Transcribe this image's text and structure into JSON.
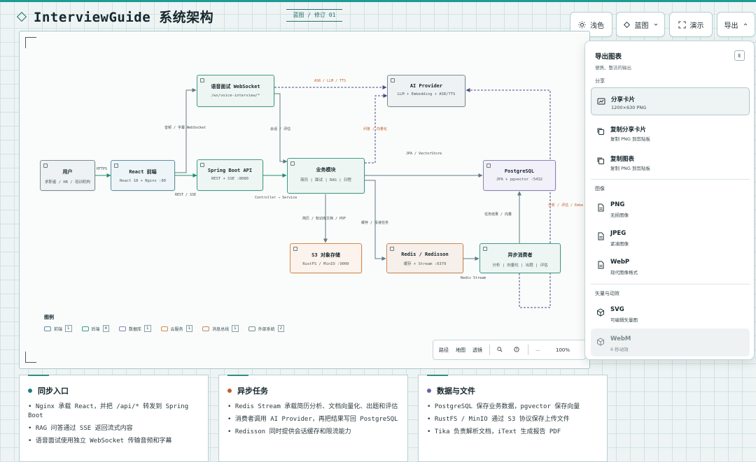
{
  "header": {
    "title": "InterviewGuide 系统架构",
    "revision": "蓝图 / 修订 01"
  },
  "toolbar": {
    "theme_label": "浅色",
    "style_label": "蓝图",
    "present_label": "演示",
    "export_label": "导出"
  },
  "diagram": {
    "nodes": {
      "user": {
        "title": "用户",
        "sub": "求职者 / HR / 培训机构"
      },
      "react": {
        "title": "React 前端",
        "sub": "React 18 + Nginx :80"
      },
      "voice": {
        "title": "语音面试 WebSocket",
        "sub": "/ws/voice-interview/*"
      },
      "spring": {
        "title": "Spring Boot API",
        "sub": "REST + SSE :8080"
      },
      "business": {
        "title": "业务模块",
        "sub": "简历 | 面试 | RAG | 日程"
      },
      "ai": {
        "title": "AI Provider",
        "sub": "LLM + Embedding + ASR/TTS"
      },
      "pg": {
        "title": "PostgreSQL",
        "sub": "JPA + pgvector :5432"
      },
      "s3": {
        "title": "S3 对象存储",
        "sub": "RustFS / MinIO :9000"
      },
      "redis": {
        "title": "Redis / Redisson",
        "sub": "缓存 + Stream :6379"
      },
      "consumer": {
        "title": "异步消费者",
        "sub": "分析 | 向量化 | 出题 | 评估"
      }
    },
    "edge_labels": {
      "https": "HTTPS",
      "rest_sse": "REST / SSE",
      "audio": "音频 / 字幕 WebSocket",
      "asr": "ASR / LLM / TTS",
      "session": "会话 / 评估",
      "controller": "Controller → Service",
      "jpa": "JPA / VectorStore",
      "prompt": "问答 / 向量化",
      "resume_pdf": "简历 / 知识库文档 / PDF",
      "cache_tasks": "缓存 / 投递任务",
      "redis_stream": "Redis Stream",
      "task_result": "任务结果 / 向量",
      "analysis": "分析 / 评估 / Embe"
    },
    "legend": {
      "title": "图例",
      "items": [
        {
          "label": "前端",
          "count": "1",
          "color": "#5d8fa0"
        },
        {
          "label": "后端",
          "count": "4",
          "color": "#3f9c8a"
        },
        {
          "label": "数据库",
          "count": "1",
          "color": "#8a84b8"
        },
        {
          "label": "云服务",
          "count": "1",
          "color": "#d98a4a"
        },
        {
          "label": "消息总线",
          "count": "1",
          "color": "#c98a58"
        },
        {
          "label": "外部系统",
          "count": "2",
          "color": "#7a8d93"
        }
      ]
    },
    "zoom": {
      "path": "路径",
      "map": "地图",
      "transparent": "透镜",
      "dash": "—",
      "level": "100%"
    }
  },
  "cards": [
    {
      "title": "同步入口",
      "dot_color": "#1a7f86",
      "items": [
        "Nginx 承载 React，并把 /api/* 转发到 Spring Boot",
        "RAG 问答通过 SSE 返回流式内容",
        "语音面试使用独立 WebSocket 传输音频和字幕"
      ]
    },
    {
      "title": "异步任务",
      "dot_color": "#c35d2a",
      "items": [
        "Redis Stream 承载简历分析、文档向量化、出题和评估",
        "消费者调用 AI Provider，再把结果写回 PostgreSQL",
        "Redisson 同时提供会话缓存和限流能力"
      ]
    },
    {
      "title": "数据与文件",
      "dot_color": "#6a5fae",
      "items": [
        "PostgreSQL 保存业务数据，pgvector 保存向量",
        "RustFS / MinIO 通过 S3 协议保存上传文件",
        "Tika 负责解析文档，iText 生成报告 PDF"
      ]
    }
  ],
  "export_menu": {
    "title": "导出图表",
    "subtitle": "便携、整洁的输出",
    "key": "E",
    "sections": {
      "share": "分享",
      "image": "图像",
      "vector": "矢量与动效"
    },
    "items": {
      "share_card": {
        "title": "分享卡片",
        "sub": "1200×630 PNG"
      },
      "copy_share": {
        "title": "复制分享卡片",
        "sub": "复制 PNG 到剪贴板"
      },
      "copy_chart": {
        "title": "复制图表",
        "sub": "复制 PNG 到剪贴板"
      },
      "png": {
        "title": "PNG",
        "sub": "无损图像"
      },
      "jpeg": {
        "title": "JPEG",
        "sub": "紧凑图像"
      },
      "webp": {
        "title": "WebP",
        "sub": "现代图像格式"
      },
      "svg": {
        "title": "SVG",
        "sub": "可编辑矢量图"
      },
      "webm": {
        "title": "WebM",
        "sub": "6 秒动效"
      }
    }
  }
}
